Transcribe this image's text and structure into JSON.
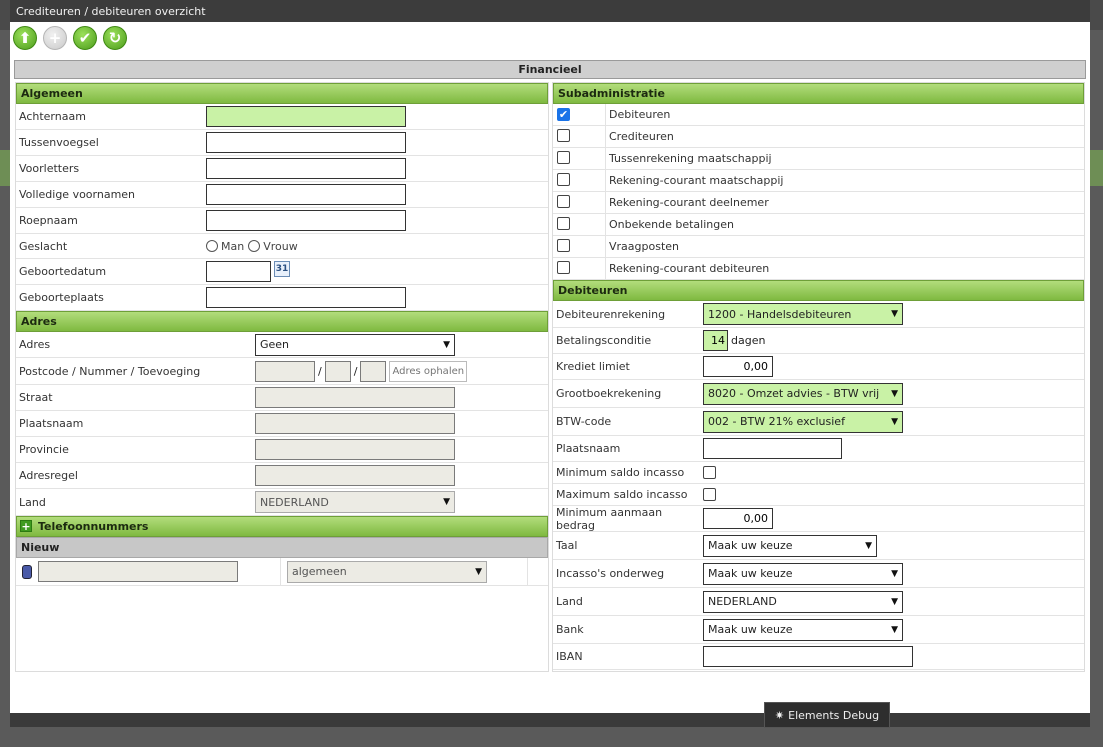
{
  "window": {
    "title": "Crediteuren / debiteuren overzicht",
    "debug_label": "Elements Debug"
  },
  "toolbar": {
    "up_glyph": "⬆",
    "add_glyph": "+",
    "save_glyph": "✔",
    "refresh_glyph": "↻"
  },
  "section": {
    "title": "Financieel"
  },
  "algemeen": {
    "header": "Algemeen",
    "achternaam": {
      "label": "Achternaam",
      "value": ""
    },
    "tussenvoegsel": {
      "label": "Tussenvoegsel",
      "value": ""
    },
    "voorletters": {
      "label": "Voorletters",
      "value": ""
    },
    "voornamen": {
      "label": "Volledige voornamen",
      "value": ""
    },
    "roepnaam": {
      "label": "Roepnaam",
      "value": ""
    },
    "geslacht": {
      "label": "Geslacht",
      "option_man": "Man",
      "option_vrouw": "Vrouw"
    },
    "geboortedatum": {
      "label": "Geboortedatum",
      "value": "",
      "cal_text": "31"
    },
    "geboorteplaats": {
      "label": "Geboorteplaats",
      "value": ""
    }
  },
  "adres": {
    "header": "Adres",
    "adres": {
      "label": "Adres",
      "selected": "Geen"
    },
    "postcode": {
      "label": "Postcode / Nummer / Toevoeging",
      "sep": "/",
      "lookup_placeholder": "Adres ophalen"
    },
    "straat": {
      "label": "Straat"
    },
    "plaatsnaam": {
      "label": "Plaatsnaam"
    },
    "provincie": {
      "label": "Provincie"
    },
    "adresregel": {
      "label": "Adresregel"
    },
    "land": {
      "label": "Land",
      "selected": "NEDERLAND"
    }
  },
  "telefoon": {
    "header": "Telefoonnummers",
    "plus": "+",
    "new_header": "Nieuw",
    "type_selected": "algemeen"
  },
  "subadministratie": {
    "header": "Subadministratie",
    "items": [
      {
        "label": "Debiteuren",
        "checked": true
      },
      {
        "label": "Crediteuren",
        "checked": false
      },
      {
        "label": "Tussenrekening maatschappij",
        "checked": false
      },
      {
        "label": "Rekening-courant maatschappij",
        "checked": false
      },
      {
        "label": "Rekening-courant deelnemer",
        "checked": false
      },
      {
        "label": "Onbekende betalingen",
        "checked": false
      },
      {
        "label": "Vraagposten",
        "checked": false
      },
      {
        "label": "Rekening-courant debiteuren",
        "checked": false
      }
    ],
    "check_glyph": "✔"
  },
  "debiteuren": {
    "header": "Debiteuren",
    "debiteurenrekening": {
      "label": "Debiteurenrekening",
      "selected": "1200 - Handelsdebiteuren"
    },
    "betalingsconditie": {
      "label": "Betalingsconditie",
      "value": "14",
      "unit": "dagen"
    },
    "kredietlimiet": {
      "label": "Krediet limiet",
      "value": "0,00"
    },
    "grootboekrekening": {
      "label": "Grootboekrekening",
      "selected": "8020 - Omzet advies - BTW vrij"
    },
    "btwcode": {
      "label": "BTW-code",
      "selected": "002 - BTW 21% exclusief"
    },
    "plaatsnaam": {
      "label": "Plaatsnaam",
      "value": ""
    },
    "min_saldo": {
      "label": "Minimum saldo incasso"
    },
    "max_saldo": {
      "label": "Maximum saldo incasso"
    },
    "min_aanmaan": {
      "label": "Minimum aanmaan bedrag",
      "value": "0,00"
    },
    "taal": {
      "label": "Taal",
      "selected": "Maak uw keuze"
    },
    "incasso": {
      "label": "Incasso's onderweg",
      "selected": "Maak uw keuze"
    },
    "land": {
      "label": "Land",
      "selected": "NEDERLAND"
    },
    "bank": {
      "label": "Bank",
      "selected": "Maak uw keuze"
    },
    "iban": {
      "label": "IBAN",
      "value": ""
    }
  },
  "colors": {
    "header_green": "#8fc650",
    "input_green": "#c9f2a6",
    "input_gray": "#ecebe4"
  }
}
